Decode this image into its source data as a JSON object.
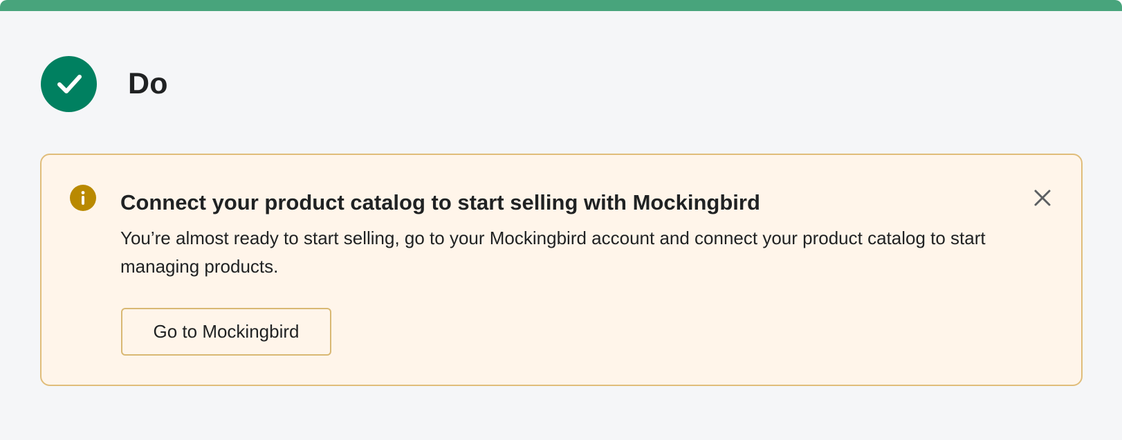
{
  "header": {
    "title": "Do",
    "badge_icon": "checkmark-icon",
    "accent_color": "#48a47c",
    "badge_color": "#008060"
  },
  "banner": {
    "status_icon": "info-icon",
    "title": "Connect your product catalog to start selling with Mockingbird",
    "body": "You’re almost ready to start selling, go to your Mockingbird account and connect your product catalog to start managing products.",
    "action_label": "Go to Mockingbird",
    "dismiss_icon": "close-icon",
    "background_color": "#fff5ea",
    "border_color": "#e0bd7a",
    "icon_color": "#b98900"
  }
}
